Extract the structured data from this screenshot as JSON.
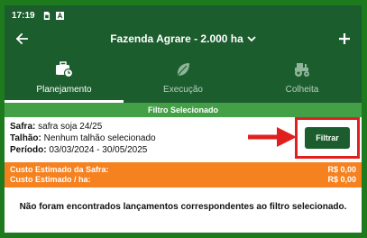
{
  "status_bar": {
    "time": "17:19",
    "icons": [
      "sim-card-icon",
      "auto-text-icon"
    ]
  },
  "app_bar": {
    "title": "Fazenda Agrare - 2.000 ha",
    "back_icon": "back-arrow-icon",
    "dropdown_icon": "chevron-down-icon",
    "add_icon": "plus-icon"
  },
  "tabs": [
    {
      "label": "Planejamento",
      "icon": "briefcase-clock-icon",
      "active": true
    },
    {
      "label": "Execução",
      "icon": "leaf-icon",
      "active": false
    },
    {
      "label": "Colheita",
      "icon": "tractor-icon",
      "active": false
    }
  ],
  "filter": {
    "header": "Filtro Selecionado",
    "safra_label": "Safra:",
    "safra_value": " safra soja 24/25",
    "talhao_label": "Talhão:",
    "talhao_value": " Nenhum talhão selecionado",
    "periodo_label": "Período:",
    "periodo_value": " 03/03/2024 - 30/05/2025",
    "button_label": "Filtrar"
  },
  "costs": {
    "safra_label": "Custo Estimado da Safra:",
    "safra_value": "R$ 0,00",
    "ha_label": "Custo Estimado / ha:",
    "ha_value": "R$ 0,00"
  },
  "message": "Não foram encontrados lançamentos correspondentes ao filtro selecionado.",
  "colors": {
    "outer_border": "#1d7a1d",
    "header_bg": "#1c5d2e",
    "filter_bar": "#43a047",
    "cost_bg": "#f5811f",
    "annotation": "#e0201e"
  }
}
